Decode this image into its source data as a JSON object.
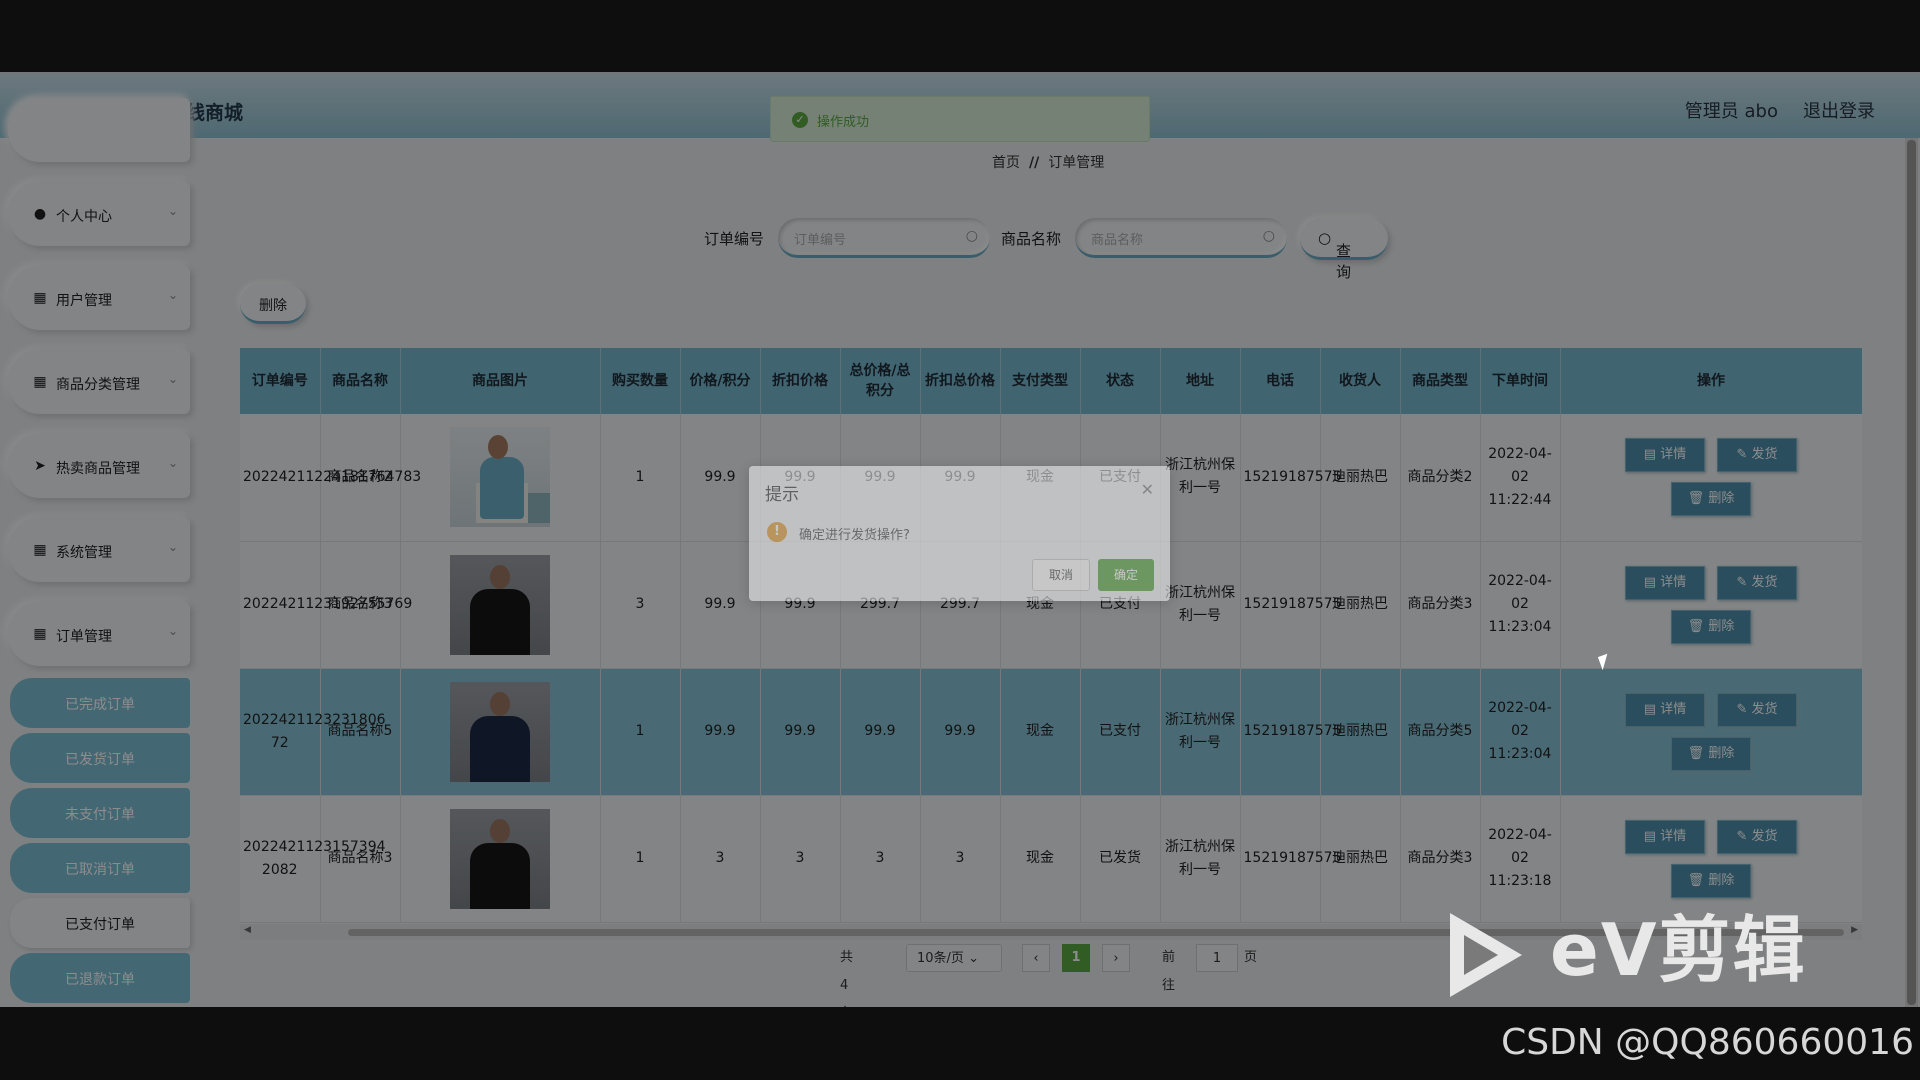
{
  "app": {
    "title": "面向品牌会员的在线商城",
    "admin_label": "管理员 abo",
    "logout_label": "退出登录"
  },
  "toast": {
    "text": "操作成功"
  },
  "breadcrumb": {
    "home": "首页",
    "separator": "//",
    "current": "订单管理"
  },
  "sidebar": {
    "menus": [
      {
        "label": "个人中心",
        "icon": "user-icon"
      },
      {
        "label": "用户管理",
        "icon": "grid-icon"
      },
      {
        "label": "商品分类管理",
        "icon": "grid-icon"
      },
      {
        "label": "热卖商品管理",
        "icon": "send-icon"
      },
      {
        "label": "系统管理",
        "icon": "grid-icon"
      },
      {
        "label": "订单管理",
        "icon": "grid-icon"
      }
    ],
    "submenu": [
      "已完成订单",
      "已发货订单",
      "未支付订单",
      "已取消订单",
      "已支付订单",
      "已退款订单"
    ],
    "active_submenu": "已支付订单"
  },
  "search": {
    "order_no_label": "订单编号",
    "order_no_placeholder": "订单编号",
    "product_label": "商品名称",
    "product_placeholder": "商品名称",
    "button": "查询"
  },
  "toolbar": {
    "delete_label": "删除"
  },
  "table": {
    "headers": [
      "订单编号",
      "商品名称",
      "商品图片",
      "购买数量",
      "价格/积分",
      "折扣价格",
      "总价格/总积分",
      "折扣总价格",
      "支付类型",
      "状态",
      "地址",
      "电话",
      "收货人",
      "商品类型",
      "下单时间",
      "操作"
    ],
    "rows": [
      {
        "order_no": "20224211224181764783",
        "name": "商品名称2",
        "image": "woman-in-blue-top",
        "qty": "1",
        "price": "99.9",
        "discount_price": "99.9",
        "total": "99.9",
        "discount_total": "99.9",
        "pay_type": "现金",
        "status": "已支付",
        "address": "浙江杭州保利一号",
        "phone": "15219187575",
        "receiver": "迪丽热巴",
        "category": "商品分类2",
        "time": "2022-04-02 11:22:44"
      },
      {
        "order_no": "2022421123192755769",
        "name": "商品名称3",
        "image": "man-in-black-tshirt",
        "qty": "3",
        "price": "99.9",
        "discount_price": "99.9",
        "total": "299.7",
        "discount_total": "299.7",
        "pay_type": "现金",
        "status": "已支付",
        "address": "浙江杭州保利一号",
        "phone": "15219187575",
        "receiver": "迪丽热巴",
        "category": "商品分类3",
        "time": "2022-04-02 11:23:04"
      },
      {
        "order_no": "2022421123231806 72",
        "name": "商品名称5",
        "image": "man-in-navy-jacket",
        "qty": "1",
        "price": "99.9",
        "discount_price": "99.9",
        "total": "99.9",
        "discount_total": "99.9",
        "pay_type": "现金",
        "status": "已支付",
        "address": "浙江杭州保利一号",
        "phone": "15219187575",
        "receiver": "迪丽热巴",
        "category": "商品分类5",
        "time": "2022-04-02 11:23:04"
      },
      {
        "order_no": "2022421123157394 2082",
        "name": "商品名称3",
        "image": "man-in-black-tshirt",
        "qty": "1",
        "price": "3",
        "discount_price": "3",
        "total": "3",
        "discount_total": "3",
        "pay_type": "现金",
        "status": "已发货",
        "address": "浙江杭州保利一号",
        "phone": "15219187575",
        "receiver": "迪丽热巴",
        "category": "商品分类3",
        "time": "2022-04-02 11:23:18"
      }
    ],
    "actions": {
      "detail": "详情",
      "ship": "发货",
      "delete": "删除"
    }
  },
  "pagination": {
    "total": "共 4 条",
    "page_size": "10条/页",
    "current_page": "1",
    "goto_label": "前往",
    "goto_value": "1",
    "page_suffix": "页"
  },
  "dialog": {
    "title": "提示",
    "message": "确定进行发货操作?",
    "cancel": "取消",
    "confirm": "确定"
  },
  "watermarks": {
    "ev": "eV剪辑",
    "csdn": "CSDN @QQ860660016"
  },
  "colors": {
    "header": "#8fbfd0",
    "table_header": "#76b6cd",
    "action_button": "#4d8fac",
    "success": "#5aa843",
    "sidebar_sub": "#7bbdd2"
  }
}
